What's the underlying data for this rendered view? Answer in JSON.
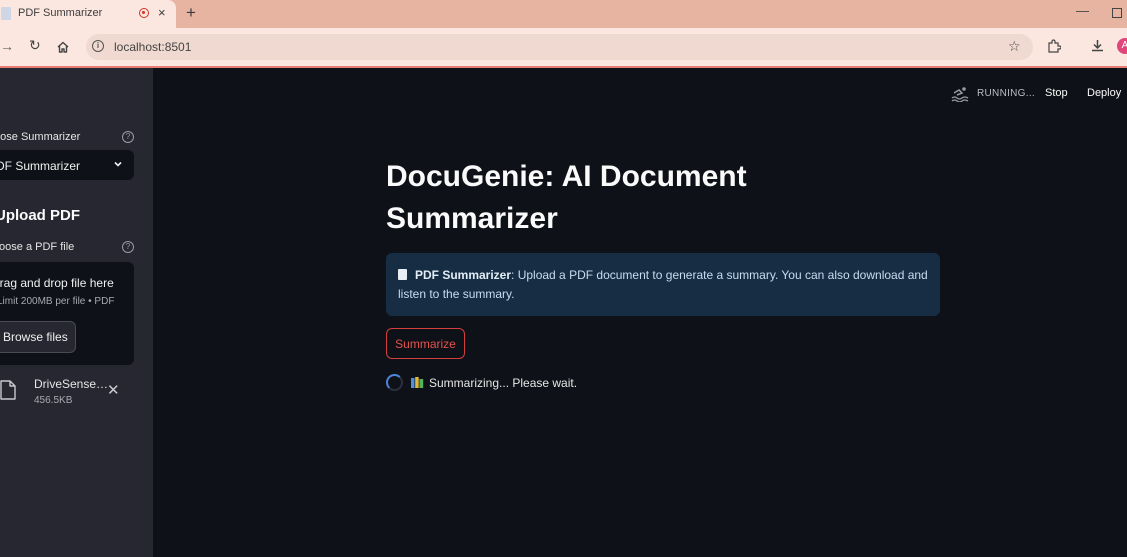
{
  "browser": {
    "tab_title": "PDF Summarizer",
    "tab_close": "×",
    "new_tab": "+",
    "url": "localhost:8501",
    "site_info_glyph": "i",
    "star": "☆",
    "reload": "↻",
    "forward": "→",
    "profile_initial": "A",
    "minimize": "—"
  },
  "sidebar": {
    "choose_label": "Choose Summarizer",
    "choose_help": "?",
    "selected_summarizer": "PDF Summarizer",
    "upload_heading": "Upload PDF",
    "file_label": "Choose a PDF file",
    "file_help": "?",
    "dropzone_title": "Drag and drop file here",
    "dropzone_limit": "Limit 200MB per file • PDF",
    "browse_label": "Browse files",
    "uploaded_file": {
      "name": "DriveSense…",
      "size": "456.5KB",
      "remove": "✕"
    }
  },
  "toolbar": {
    "status": "RUNNING...",
    "stop_label": "Stop",
    "deploy_label": "Deploy"
  },
  "main": {
    "title": "DocuGenie: AI Document Summarizer",
    "info_strong": "PDF Summarizer",
    "info_text": ": Upload a PDF document to generate a summary. You can also download and listen to the summary.",
    "summarize_label": "Summarize",
    "status_text": "Summarizing... Please wait."
  },
  "colors": {
    "app_bg": "#0e1117",
    "sidebar_bg": "#262730",
    "accent_red": "#d2403d",
    "info_bg": "#172d43",
    "browser_tabbar": "#e8b4a2"
  }
}
